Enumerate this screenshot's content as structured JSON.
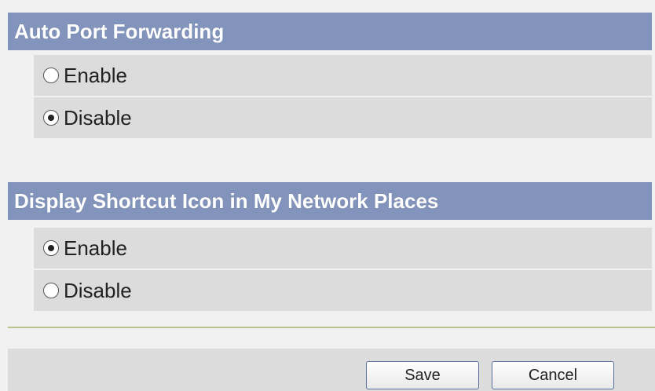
{
  "sections": [
    {
      "title": "Auto Port Forwarding",
      "options": [
        {
          "label": "Enable",
          "checked": false
        },
        {
          "label": "Disable",
          "checked": true
        }
      ]
    },
    {
      "title": "Display Shortcut Icon in My Network Places",
      "options": [
        {
          "label": "Enable",
          "checked": true
        },
        {
          "label": "Disable",
          "checked": false
        }
      ]
    }
  ],
  "buttons": {
    "save_label": "Save",
    "cancel_label": "Cancel"
  },
  "colors": {
    "header_bg": "#8294bb",
    "row_bg": "#dcdcdc",
    "page_bg": "#f1f1f1",
    "divider": "#b9c38a"
  }
}
